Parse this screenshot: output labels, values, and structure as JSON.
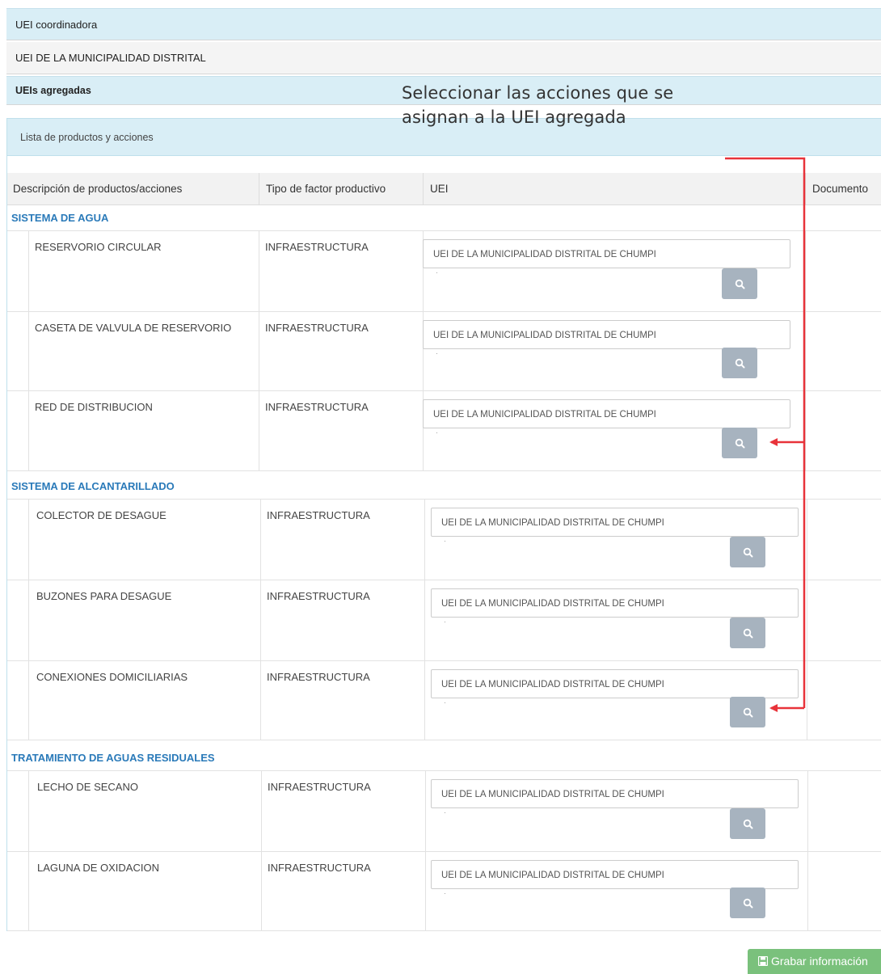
{
  "header": {
    "coordinadora_label": "UEI coordinadora",
    "coordinadora_value": "UEI DE LA MUNICIPALIDAD DISTRITAL",
    "agregadas_label": "UEIs agregadas"
  },
  "annotation": {
    "line1": "Seleccionar las acciones que se",
    "line2": "asignan a la UEI agregada",
    "color": "#e8333a"
  },
  "panel": {
    "title": "Lista de productos y acciones",
    "columns": [
      "Descripción de productos/acciones",
      "Tipo de factor productivo",
      "UEI",
      "Documento"
    ]
  },
  "groups": [
    {
      "name": "SISTEMA DE AGUA",
      "rows": [
        {
          "desc": "RESERVORIO CIRCULAR",
          "tipo": "INFRAESTRUCTURA",
          "uei": "UEI DE LA MUNICIPALIDAD DISTRITAL DE CHUMPI"
        },
        {
          "desc": "CASETA DE VALVULA DE RESERVORIO",
          "tipo": "INFRAESTRUCTURA",
          "uei": "UEI DE LA MUNICIPALIDAD DISTRITAL DE CHUMPI"
        },
        {
          "desc": "RED DE DISTRIBUCION",
          "tipo": "INFRAESTRUCTURA",
          "uei": "UEI DE LA MUNICIPALIDAD DISTRITAL DE CHUMPI"
        }
      ]
    },
    {
      "name": "SISTEMA DE ALCANTARILLADO",
      "rows": [
        {
          "desc": "COLECTOR DE DESAGUE",
          "tipo": "INFRAESTRUCTURA",
          "uei": "UEI DE LA MUNICIPALIDAD DISTRITAL DE CHUMPI"
        },
        {
          "desc": "BUZONES PARA DESAGUE",
          "tipo": "INFRAESTRUCTURA",
          "uei": "UEI DE LA MUNICIPALIDAD DISTRITAL DE CHUMPI"
        },
        {
          "desc": "CONEXIONES DOMICILIARIAS",
          "tipo": "INFRAESTRUCTURA",
          "uei": "UEI DE LA MUNICIPALIDAD DISTRITAL DE CHUMPI"
        }
      ]
    },
    {
      "name": "TRATAMIENTO DE AGUAS RESIDUALES",
      "rows": [
        {
          "desc": "LECHO DE SECANO",
          "tipo": "INFRAESTRUCTURA",
          "uei": "UEI DE LA MUNICIPALIDAD DISTRITAL DE CHUMPI"
        },
        {
          "desc": "LAGUNA DE OXIDACION",
          "tipo": "INFRAESTRUCTURA",
          "uei": "UEI DE LA MUNICIPALIDAD DISTRITAL DE CHUMPI"
        }
      ]
    }
  ],
  "save_button": {
    "label": "Grabar información",
    "icon": "floppy-icon"
  },
  "row_search_icon": "search-icon"
}
